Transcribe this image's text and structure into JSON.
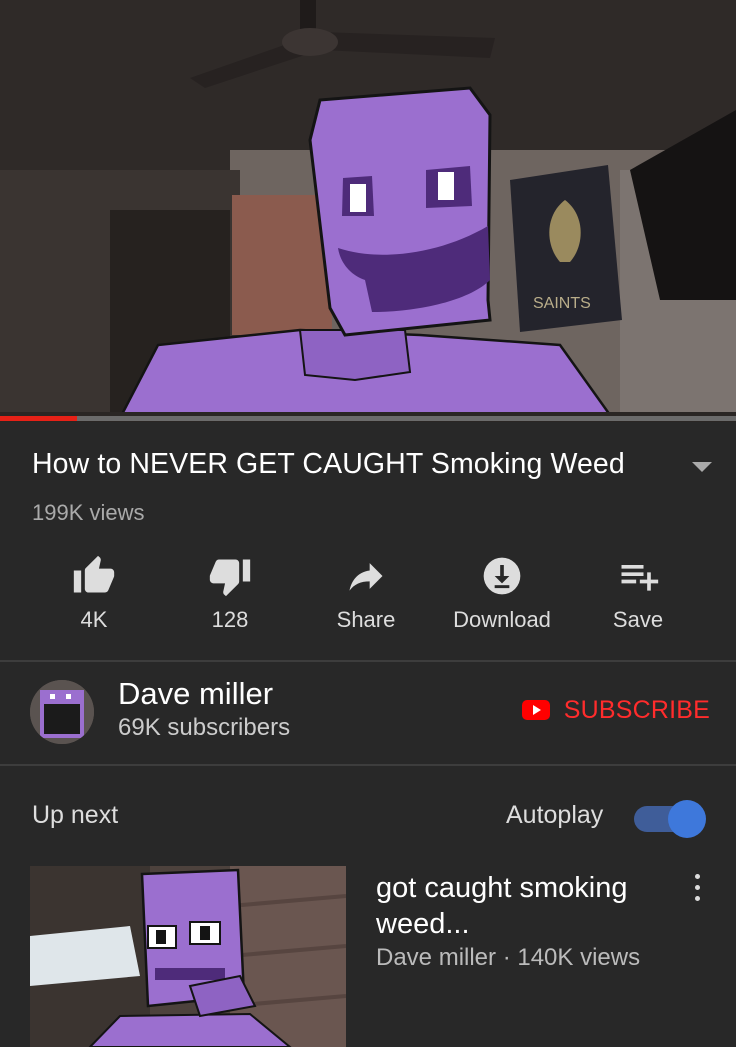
{
  "player": {
    "progress_fraction": 0.105,
    "poster_text": "SAINTS"
  },
  "video": {
    "title": "How to NEVER GET CAUGHT Smoking Weed",
    "views": "199K views"
  },
  "actions": {
    "like_count": "4K",
    "dislike_count": "128",
    "share_label": "Share",
    "download_label": "Download",
    "save_label": "Save"
  },
  "channel": {
    "name": "Dave miller",
    "subscribers": "69K subscribers",
    "subscribe_label": "SUBSCRIBE"
  },
  "up_next": {
    "label": "Up next",
    "autoplay_label": "Autoplay",
    "autoplay_on": true
  },
  "next_video": {
    "title": "got caught smoking weed...",
    "meta": "Dave miller · 140K views"
  },
  "colors": {
    "background": "#282828",
    "accent_red": "#ff2c2c",
    "toggle_blue": "#3e78db",
    "character_purple": "#9b6fcf"
  }
}
